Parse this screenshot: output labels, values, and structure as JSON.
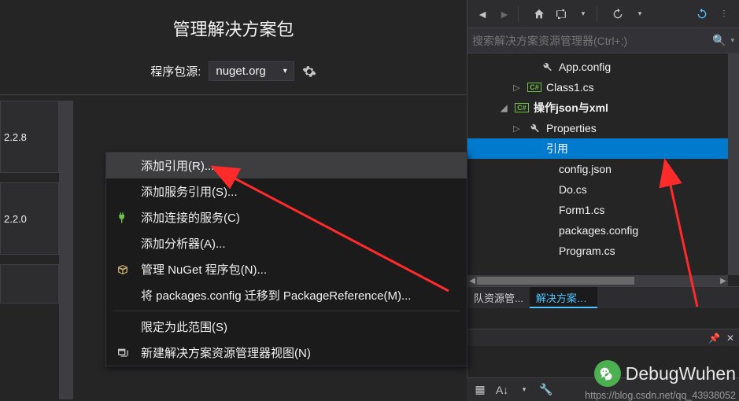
{
  "main": {
    "title": "管理解决方案包",
    "pkg_source_label": "程序包源:",
    "pkg_source_value": "nuget.org",
    "left_versions": [
      "2.2.8",
      "2.2.0"
    ]
  },
  "context_menu": {
    "items": [
      {
        "label": "添加引用(R)...",
        "icon": "",
        "hover": true
      },
      {
        "label": "添加服务引用(S)...",
        "icon": "",
        "hover": false
      },
      {
        "label": "添加连接的服务(C)",
        "icon": "plug",
        "hover": false
      },
      {
        "label": "添加分析器(A)...",
        "icon": "",
        "hover": false
      },
      {
        "label": "管理 NuGet 程序包(N)...",
        "icon": "package",
        "hover": false
      },
      {
        "label": "将 packages.config 迁移到 PackageReference(M)...",
        "icon": "",
        "hover": false
      }
    ],
    "items2": [
      {
        "label": "限定为此范围(S)",
        "icon": "",
        "hover": false
      },
      {
        "label": "新建解决方案资源管理器视图(N)",
        "icon": "window",
        "hover": false
      }
    ]
  },
  "solution": {
    "search_placeholder": "搜索解决方案资源管理器(Ctrl+;)",
    "nodes": [
      {
        "indent": 44,
        "exp": "",
        "icon": "wrench",
        "label": "App.config",
        "sel": false,
        "bold": false
      },
      {
        "indent": 28,
        "exp": "▷",
        "icon": "cs",
        "label": "Class1.cs",
        "sel": false,
        "bold": false
      },
      {
        "indent": 12,
        "exp": "◢",
        "icon": "csproj",
        "label": "操作json与xml",
        "sel": false,
        "bold": true
      },
      {
        "indent": 28,
        "exp": "▷",
        "icon": "wrench",
        "label": "Properties",
        "sel": false,
        "bold": false
      },
      {
        "indent": 28,
        "exp": "",
        "icon": "",
        "label": "引用",
        "sel": true,
        "bold": false
      },
      {
        "indent": 44,
        "exp": "",
        "icon": "",
        "label": "config.json",
        "sel": false,
        "bold": false
      },
      {
        "indent": 44,
        "exp": "",
        "icon": "",
        "label": "Do.cs",
        "sel": false,
        "bold": false
      },
      {
        "indent": 44,
        "exp": "",
        "icon": "",
        "label": "Form1.cs",
        "sel": false,
        "bold": false
      },
      {
        "indent": 44,
        "exp": "",
        "icon": "",
        "label": "packages.config",
        "sel": false,
        "bold": false
      },
      {
        "indent": 44,
        "exp": "",
        "icon": "",
        "label": "Program.cs",
        "sel": false,
        "bold": false
      }
    ],
    "tabs": [
      {
        "label": "队资源管...",
        "active": false
      },
      {
        "label": "解决方案资...",
        "active": true
      }
    ]
  },
  "watermark": {
    "text": "DebugWuhen",
    "url": "https://blog.csdn.net/qq_43938052"
  }
}
